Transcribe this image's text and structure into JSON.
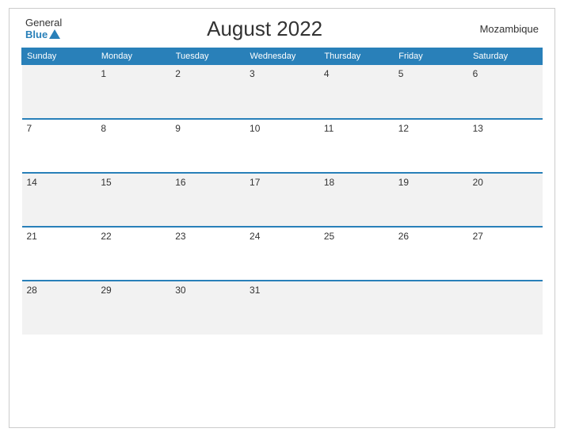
{
  "header": {
    "logo_general": "General",
    "logo_blue": "Blue",
    "title": "August 2022",
    "country": "Mozambique"
  },
  "weekdays": [
    "Sunday",
    "Monday",
    "Tuesday",
    "Wednesday",
    "Thursday",
    "Friday",
    "Saturday"
  ],
  "weeks": [
    [
      "",
      "1",
      "2",
      "3",
      "4",
      "5",
      "6"
    ],
    [
      "7",
      "8",
      "9",
      "10",
      "11",
      "12",
      "13"
    ],
    [
      "14",
      "15",
      "16",
      "17",
      "18",
      "19",
      "20"
    ],
    [
      "21",
      "22",
      "23",
      "24",
      "25",
      "26",
      "27"
    ],
    [
      "28",
      "29",
      "30",
      "31",
      "",
      "",
      ""
    ]
  ]
}
